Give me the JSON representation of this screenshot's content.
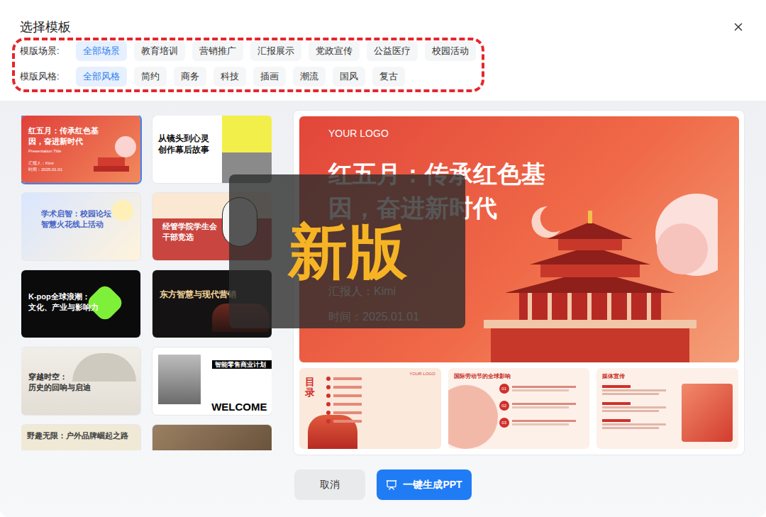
{
  "dialog": {
    "title": "选择模板"
  },
  "filters": [
    {
      "label": "模版场景:",
      "options": [
        {
          "label": "全部场景",
          "selected": true
        },
        {
          "label": "教育培训",
          "selected": false
        },
        {
          "label": "营销推广",
          "selected": false
        },
        {
          "label": "汇报展示",
          "selected": false
        },
        {
          "label": "党政宣传",
          "selected": false
        },
        {
          "label": "公益医疗",
          "selected": false
        },
        {
          "label": "校园活动",
          "selected": false
        }
      ]
    },
    {
      "label": "模版风格:",
      "options": [
        {
          "label": "全部风格",
          "selected": true
        },
        {
          "label": "简约",
          "selected": false
        },
        {
          "label": "商务",
          "selected": false
        },
        {
          "label": "科技",
          "selected": false
        },
        {
          "label": "插画",
          "selected": false
        },
        {
          "label": "潮流",
          "selected": false
        },
        {
          "label": "国风",
          "selected": false
        },
        {
          "label": "复古",
          "selected": false
        }
      ]
    }
  ],
  "thumbnails": [
    {
      "title": "红五月：传承红色基因，奋进新时代",
      "subtitle": "Presentation Title",
      "meta": [
        "汇报人：Kimi",
        "时间：2025.01.01"
      ],
      "kind": "red",
      "selected": true
    },
    {
      "title": "从镜头到心灵\n创作幕后故事",
      "kind": "white",
      "selected": false
    },
    {
      "title": "学术启智：校园论坛\n智慧火花线上活动",
      "kind": "blue",
      "selected": false
    },
    {
      "title": "经管学院学生会\n干部竞选",
      "kind": "cream",
      "selected": false
    },
    {
      "title": "K-pop全球浪潮：\n文化、产业与影响力",
      "kind": "neon",
      "selected": false
    },
    {
      "title": "东方智慧与现代营销",
      "kind": "black",
      "selected": false
    },
    {
      "title": "穿越时空：\n历史的回响与启迪",
      "kind": "ink",
      "selected": false
    },
    {
      "title": "智能零售商业计划",
      "extra": "WELCOME",
      "kind": "mono",
      "selected": false
    },
    {
      "title": "野趣无限：户外品牌崛起之路",
      "kind": "beige",
      "selected": false
    },
    {
      "kind": "photo",
      "selected": false
    }
  ],
  "preview": {
    "logo": "YOUR LOGO",
    "title": "红五月：传承红色基因，奋进新时代",
    "presenter": "汇报人：Kimi",
    "date": "时间：2025.01.01",
    "pages": [
      {
        "kind": "toc",
        "title": "目录",
        "logo": "YOUR LOGO"
      },
      {
        "kind": "points",
        "title": "国际劳动节的全球影响",
        "points": [
          "01",
          "02",
          "03"
        ]
      },
      {
        "kind": "cards",
        "title": "媒体宣传"
      }
    ]
  },
  "badge": "新版",
  "buttons": [
    {
      "label": "取消",
      "kind": "secondary"
    },
    {
      "label": "一键生成PPT",
      "kind": "primary"
    }
  ]
}
